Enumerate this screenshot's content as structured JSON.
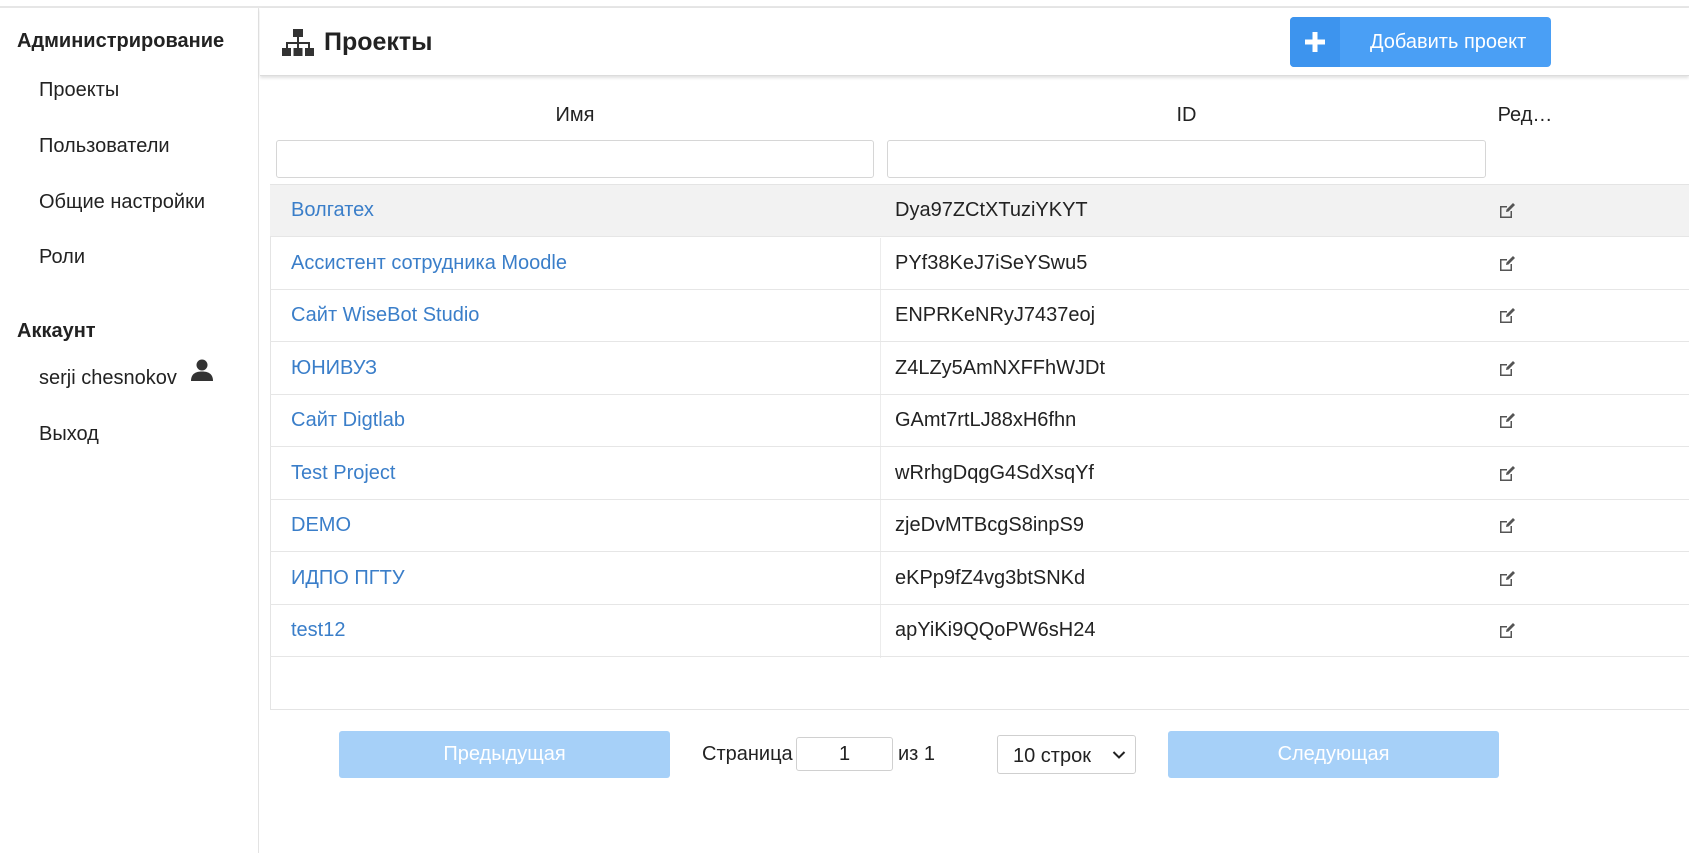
{
  "sidebar": {
    "admin_title": "Администрирование",
    "admin_items": [
      {
        "label": "Проекты"
      },
      {
        "label": "Пользователи"
      },
      {
        "label": "Общие настройки"
      },
      {
        "label": "Роли"
      }
    ],
    "account_title": "Аккаунт",
    "user_name": "serji chesnokov",
    "user_icon": "user-icon",
    "logout": "Выход"
  },
  "header": {
    "title": "Проекты",
    "title_icon": "sitemap-icon",
    "add_button": "Добавить проект",
    "add_icon": "plus-icon"
  },
  "table": {
    "columns": {
      "name": "Имя",
      "id": "ID",
      "edit": "Ред…"
    },
    "filters": {
      "name": "",
      "id": ""
    },
    "rows": [
      {
        "name": "Волгатех",
        "id": "Dya97ZCtXTuziYKYT"
      },
      {
        "name": "Ассистент сотрудника Moodle",
        "id": "PYf38KeJ7iSeYSwu5"
      },
      {
        "name": "Сайт WiseBot Studio",
        "id": "ENPRKeNRyJ7437eoj"
      },
      {
        "name": "ЮНИВУЗ",
        "id": "Z4LZy5AmNXFFhWJDt"
      },
      {
        "name": "Сайт Digtlab",
        "id": "GAmt7rtLJ88xH6fhn"
      },
      {
        "name": "Test Project",
        "id": "wRrhgDqgG4SdXsqYf"
      },
      {
        "name": "DEMO",
        "id": "zjeDvMTBcgS8inpS9"
      },
      {
        "name": "ИДПО ПГТУ",
        "id": "eKPp9fZ4vg3btSNKd"
      },
      {
        "name": "test12",
        "id": "apYiKi9QQoPW6sH24"
      }
    ]
  },
  "pagination": {
    "prev": "Предыдущая",
    "page_label": "Страница",
    "page_value": "1",
    "of_label": "из 1",
    "rows_select": "10 строк",
    "next": "Следующая"
  },
  "colors": {
    "accent": "#4a9ff5",
    "link": "#3a7ec9",
    "disabled_button": "#a6d0f8"
  }
}
